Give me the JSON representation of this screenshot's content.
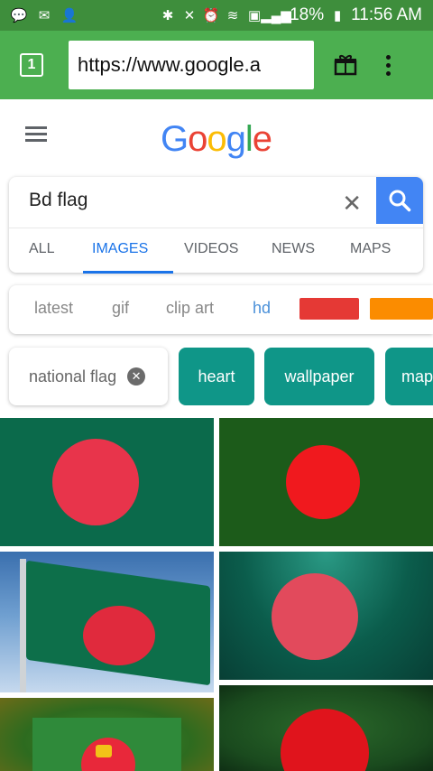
{
  "status_bar": {
    "icons_left": [
      "messages-icon",
      "messenger-icon",
      "add-contact-icon"
    ],
    "icons_right": [
      "bluetooth-icon",
      "mute-icon",
      "alarm-icon",
      "wifi-icon",
      "nfc-icon",
      "signal-icon"
    ],
    "battery": "18%",
    "time": "11:56 AM"
  },
  "browser": {
    "tab_count": "1",
    "url": "https://www.google.a"
  },
  "google": {
    "logo_letters": [
      {
        "ch": "G",
        "color": "#4285f4"
      },
      {
        "ch": "o",
        "color": "#ea4335"
      },
      {
        "ch": "o",
        "color": "#fbbc05"
      },
      {
        "ch": "g",
        "color": "#4285f4"
      },
      {
        "ch": "l",
        "color": "#34a853"
      },
      {
        "ch": "e",
        "color": "#ea4335"
      }
    ],
    "query": "Bd flag",
    "tabs": [
      "ALL",
      "IMAGES",
      "VIDEOS",
      "NEWS",
      "MAPS"
    ],
    "active_tab": "IMAGES"
  },
  "filters": {
    "labels": [
      "latest",
      "gif",
      "clip art",
      "hd"
    ],
    "swatch_colors": [
      "#e53935",
      "#fb8c00"
    ]
  },
  "chips": {
    "selected": "national flag",
    "suggestions": [
      "heart",
      "wallpaper",
      "map"
    ]
  },
  "results": {
    "count": 6,
    "flag_green": "#006a4e",
    "flag_red": "#f42a41"
  }
}
